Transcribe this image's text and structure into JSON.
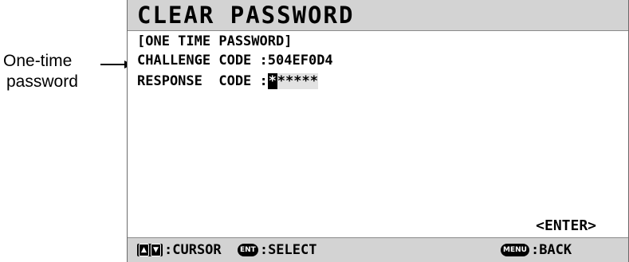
{
  "annotation": {
    "line1": "One-time",
    "line2": "password"
  },
  "screen": {
    "title": "CLEAR PASSWORD",
    "section_header": "[ONE TIME PASSWORD]",
    "challenge": {
      "label": "CHALLENGE CODE",
      "sep": " :",
      "value": "504EF0D4"
    },
    "response": {
      "label": "RESPONSE  CODE",
      "sep": " :",
      "cursor_char": "*",
      "masked_rest": "*****"
    },
    "enter_label": "<ENTER>"
  },
  "bottom_bar": {
    "cursor": {
      "key_up": "▲",
      "key_down": "▼",
      "label": ":CURSOR"
    },
    "select": {
      "key": "ENT",
      "label": ":SELECT"
    },
    "back": {
      "key": "MENU",
      "label": ":BACK"
    }
  }
}
